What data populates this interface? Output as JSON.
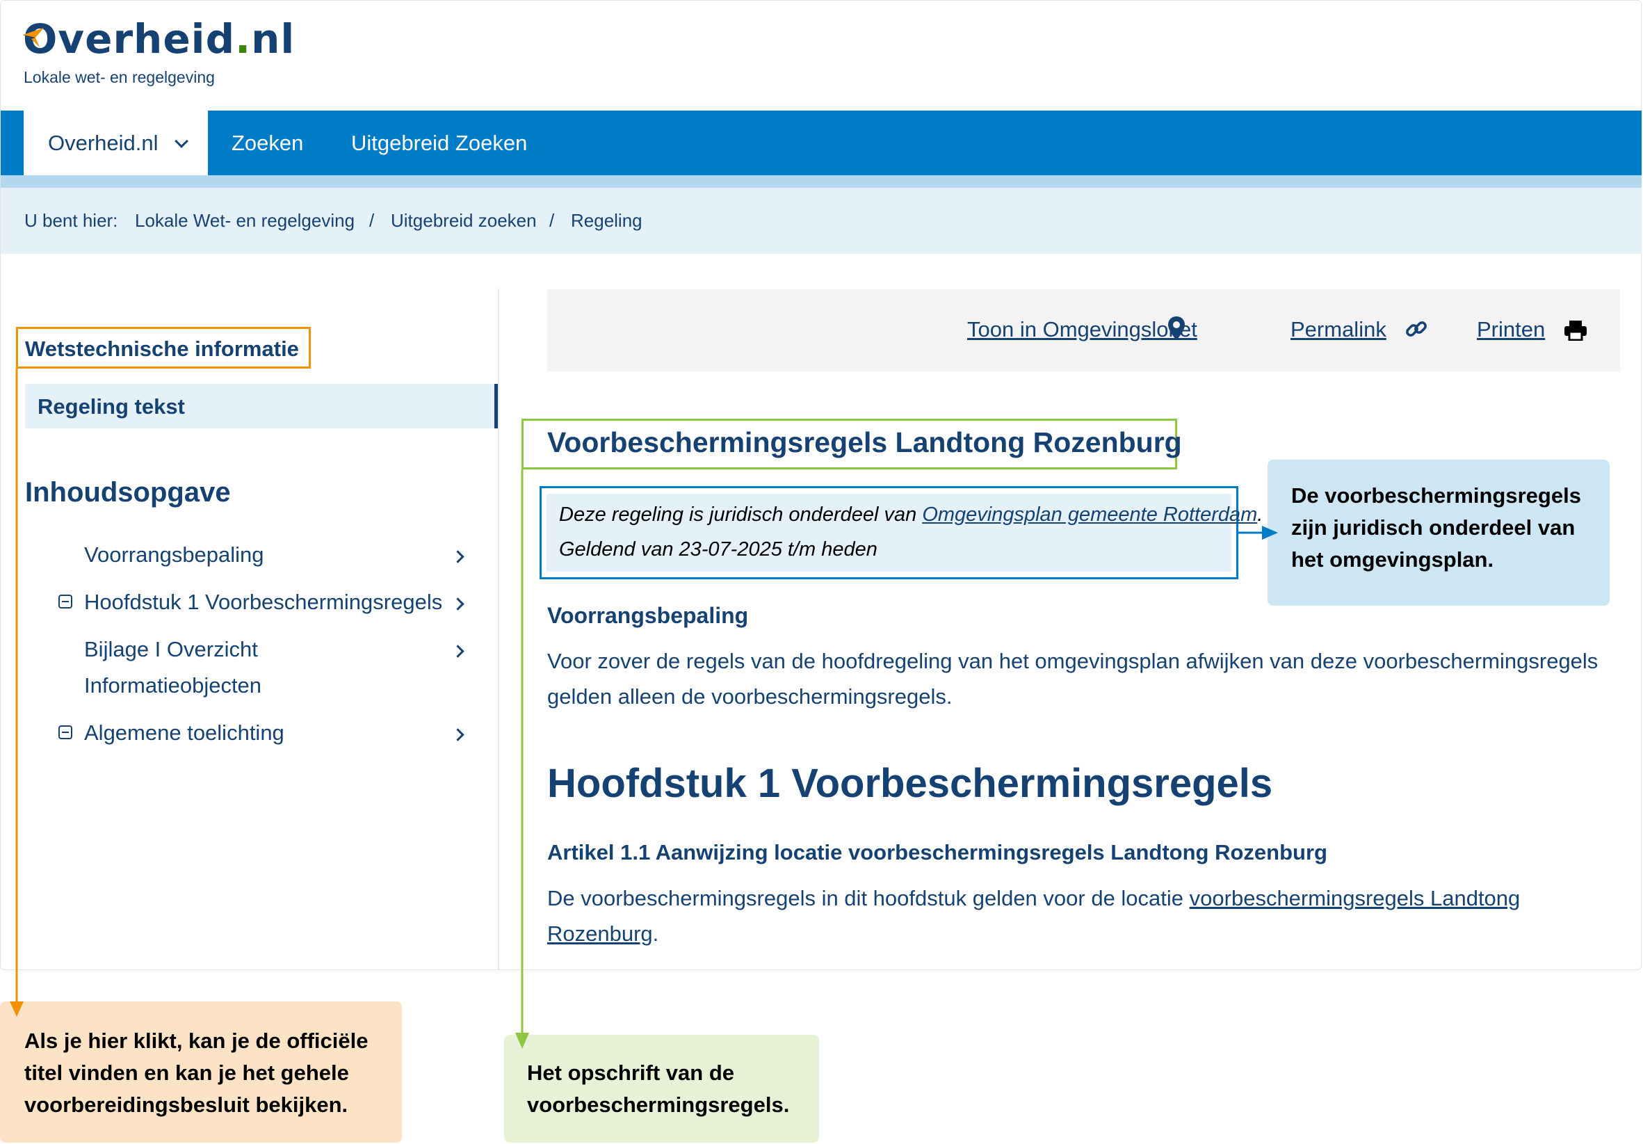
{
  "header": {
    "logo_text": "Overheid",
    "logo_suffix": "nl",
    "subtitle": "Lokale wet- en regelgeving"
  },
  "nav": {
    "active": "Overheid.nl",
    "items": [
      "Zoeken",
      "Uitgebreid Zoeken"
    ]
  },
  "breadcrumb": {
    "prefix": "U bent hier:",
    "items": [
      "Lokale Wet- en regelgeving",
      "Uitgebreid zoeken",
      "Regeling"
    ],
    "separator": "/"
  },
  "sidebar": {
    "wetstechnisch": "Wetstechnische informatie",
    "regeling_tekst": "Regeling tekst",
    "toc_title": "Inhoudsopgave",
    "toc": [
      {
        "label": "Voorrangsbepaling"
      },
      {
        "label": "Hoofdstuk 1 Voorbeschermingsregels"
      },
      {
        "label_line1": "Bijlage I Overzicht",
        "label_line2": "Informatieobjecten"
      },
      {
        "label": "Algemene toelichting"
      }
    ]
  },
  "actions": {
    "omgevingsloket": "Toon in Omgevingsloket",
    "permalink": "Permalink",
    "printen": "Printen"
  },
  "regeling": {
    "title": "Voorbeschermingsregels Landtong Rozenburg",
    "notice_prefix": "Deze regeling is juridisch onderdeel van ",
    "notice_link": "Omgevingsplan gemeente Rotterdam",
    "notice_suffix": ".",
    "geldend": "Geldend van 23-07-2025 t/m heden",
    "voorrang_heading": "Voorrangsbepaling",
    "voorrang_text_line1": "Voor zover de regels van de hoofdregeling van het omgevingsplan afwijken van deze voorbeschermingsregels",
    "voorrang_text_line2": "gelden alleen de voorbeschermingsregels.",
    "hoofdstuk_heading": "Hoofdstuk 1 Voorbeschermingsregels",
    "artikel_heading": "Artikel 1.1 Aanwijzing locatie voorbeschermingsregels Landtong Rozenburg",
    "artikel_text_prefix": "De voorbeschermingsregels in dit hoofdstuk gelden voor de locatie ",
    "artikel_link_line1": "voorbeschermingsregels Landtong",
    "artikel_link_line2": "Rozenburg",
    "artikel_suffix": "."
  },
  "callouts": {
    "blue": [
      "De voorbeschermingsregels",
      "zijn juridisch onderdeel van",
      "het omgevingsplan."
    ],
    "orange": [
      "Als je hier klikt, kan je de officiële",
      "titel vinden en kan je het gehele",
      "voorbereidingsbesluit bekijken."
    ],
    "green": [
      "Het opschrift van de",
      "voorbeschermingsregels."
    ]
  },
  "colors": {
    "brand_blue": "#007bc7",
    "text_blue": "#154273",
    "orange": "#f39200",
    "green": "#8dc63f"
  }
}
